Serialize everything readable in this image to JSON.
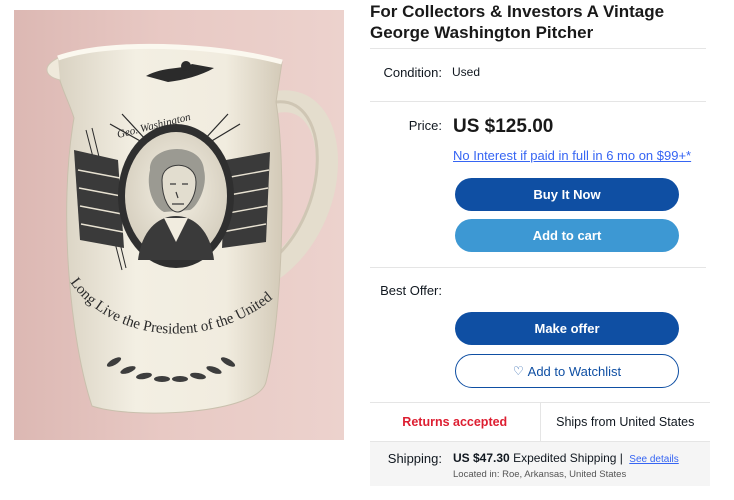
{
  "listing": {
    "title": "For Collectors & Investors A Vintage George Washington Pitcher",
    "image_alt": "Vintage George Washington pitcher",
    "pitcher_text": {
      "name_banner": "Geo. Washington",
      "motto": "Long Live the President of the United States"
    }
  },
  "condition": {
    "label": "Condition:",
    "value": "Used"
  },
  "price": {
    "label": "Price:",
    "value": "US $125.00",
    "financing": "No Interest if paid in full in 6 mo on $99+*"
  },
  "buttons": {
    "buy_now": "Buy It Now",
    "add_to_cart": "Add to cart",
    "make_offer": "Make offer",
    "watchlist": "Add to Watchlist"
  },
  "best_offer": {
    "label": "Best Offer:"
  },
  "returns": {
    "left": "Returns accepted",
    "right": "Ships from United States"
  },
  "shipping": {
    "label": "Shipping:",
    "amount": "US $47.30",
    "method": "Expedited Shipping |",
    "details_link": "See details",
    "location": "Located in: Roe, Arkansas, United States"
  },
  "colors": {
    "primary_button": "#0f4fa3",
    "secondary_button": "#3d98d3",
    "link": "#3665f3",
    "returns_red": "#dd1e31"
  },
  "icons": {
    "watchlist": "heart-outline-icon"
  }
}
